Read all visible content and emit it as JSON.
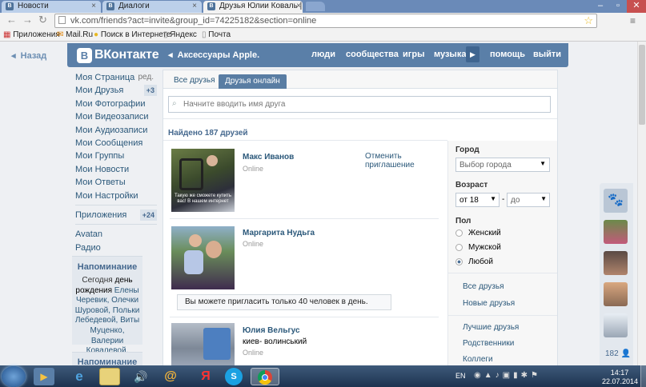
{
  "browser": {
    "tabs": [
      {
        "title": "Новости",
        "active": false
      },
      {
        "title": "Диалоги",
        "active": false
      },
      {
        "title": "Друзья Юлии Коваль | 33",
        "active": true
      }
    ],
    "url": "vk.com/friends?act=invite&group_id=74225182&section=online",
    "bookmarks": [
      "Приложения",
      "Mail.Ru",
      "Поиск в Интернете",
      "Яндекс",
      "Почта"
    ]
  },
  "vk": {
    "back_label": "Назад",
    "logo": "ВКонтакте",
    "group_crumb": "Аксессуары Apple.",
    "top_nav": [
      "люди",
      "сообщества",
      "игры",
      "музыка",
      "помощь",
      "выйти"
    ],
    "left_menu": [
      {
        "label": "Моя Страница",
        "extra": "ред."
      },
      {
        "label": "Мои Друзья",
        "extra": "+3"
      },
      {
        "label": "Мои Фотографии"
      },
      {
        "label": "Мои Видеозаписи"
      },
      {
        "label": "Мои Аудиозаписи"
      },
      {
        "label": "Мои Сообщения"
      },
      {
        "label": "Мои Группы"
      },
      {
        "label": "Мои Новости"
      },
      {
        "label": "Мои Ответы"
      },
      {
        "label": "Мои Настройки"
      }
    ],
    "apps": {
      "label": "Приложения",
      "count": "+24"
    },
    "extra_links": [
      "Avatan",
      "Радио"
    ],
    "reminder": {
      "title": "Напоминание",
      "text_before": "Сегодня ",
      "text_bold": "день рождения",
      "text_names": " Елены Черевик, Олечки Шуровой, Польки Лебедевой, Виты Муценко, Валерии Ковалевой, Ирины Правдиной."
    },
    "reminder2_title": "Напоминание",
    "tabs": [
      "Все друзья",
      "Друзья онлайн"
    ],
    "search_placeholder": "Начните вводить имя друга",
    "found": "Найдено 187 друзей",
    "friends": [
      {
        "name": "Макс Иванов",
        "status": "Online",
        "action": "Отменить приглашение",
        "photo_caption": "Такую же сможете купить вас! В нашем интернет"
      },
      {
        "name": "Маргарита Нудьга",
        "status": "Online"
      },
      {
        "name": "Юлия Вельгус",
        "city": "киев- волинський",
        "status": "Online"
      }
    ],
    "invite_limit_notice": "Вы можете пригласить только 40 человек в день.",
    "filters": {
      "city_label": "Город",
      "city_select": "Выбор города",
      "age_label": "Возраст",
      "age_from": "от 18",
      "age_dash": "-",
      "age_to": "до",
      "sex_label": "Пол",
      "sex_options": [
        "Женский",
        "Мужской",
        "Любой"
      ],
      "sex_selected": "Любой",
      "links": [
        "Все друзья",
        "Новые друзья",
        "Лучшие друзья",
        "Родственники",
        "Коллеги"
      ]
    },
    "right_rail_count": "182"
  },
  "taskbar": {
    "lang": "EN",
    "time": "14:17",
    "date": "22.07.2014"
  }
}
